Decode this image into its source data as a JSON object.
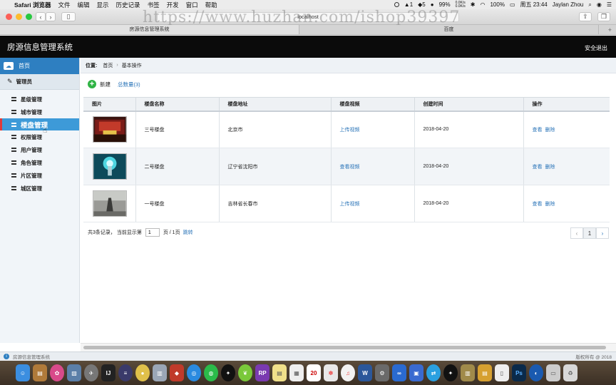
{
  "menubar": {
    "app_name": "Safari 浏览器",
    "items": [
      "文件",
      "编辑",
      "显示",
      "历史记录",
      "书签",
      "开发",
      "窗口",
      "帮助"
    ],
    "status": {
      "notif_count": "1",
      "qq_count": "5",
      "battery": "99%",
      "net_up": "0.0K/s",
      "net_down": "0.0K/s",
      "battery2": "100%",
      "datetime": "周五 23:44",
      "user": "Jaylan Zhou"
    }
  },
  "browser": {
    "url": "localhost",
    "tabs": [
      "房源信息管理系统",
      "百度"
    ],
    "watermark": "https://www.huzhan.com/ishop39397"
  },
  "header": {
    "title": "房源信息管理系统",
    "logout": "安全退出"
  },
  "sidebar": {
    "home": "首页",
    "group": "管理员",
    "items": [
      "星级管理",
      "城市管理",
      "楼盘管理",
      "权限管理",
      "用户管理",
      "角色管理",
      "片区管理",
      "城区管理"
    ],
    "active_index": 2
  },
  "breadcrumb": {
    "label": "位置:",
    "home": "首页",
    "current": "基本操作"
  },
  "actions": {
    "add": "新建",
    "total": "总数量(3)"
  },
  "table": {
    "headers": [
      "图片",
      "楼盘名称",
      "楼盘地址",
      "楼盘视频",
      "创建时间",
      "操作"
    ],
    "rows": [
      {
        "name": "三号楼盘",
        "address": "北京市",
        "video": "上传视频",
        "created": "2018-04-20",
        "view": "查看",
        "delete": "删除"
      },
      {
        "name": "二号楼盘",
        "address": "辽宁省沈阳市",
        "video": "查看视频",
        "created": "2018-04-20",
        "view": "查看",
        "delete": "删除"
      },
      {
        "name": "一号楼盘",
        "address": "吉林省长春市",
        "video": "上传视频",
        "created": "2018-04-20",
        "view": "查看",
        "delete": "删除"
      }
    ]
  },
  "pager": {
    "summary": "共3条记录， 当前显示第",
    "page_value": "1",
    "pages": "页 / 1页",
    "jump": "跳转",
    "prev": "‹",
    "current": "1",
    "next": "›"
  },
  "statusbar": {
    "system": "房源信息管理系统",
    "copyright": "版权所有 @ 2018"
  }
}
